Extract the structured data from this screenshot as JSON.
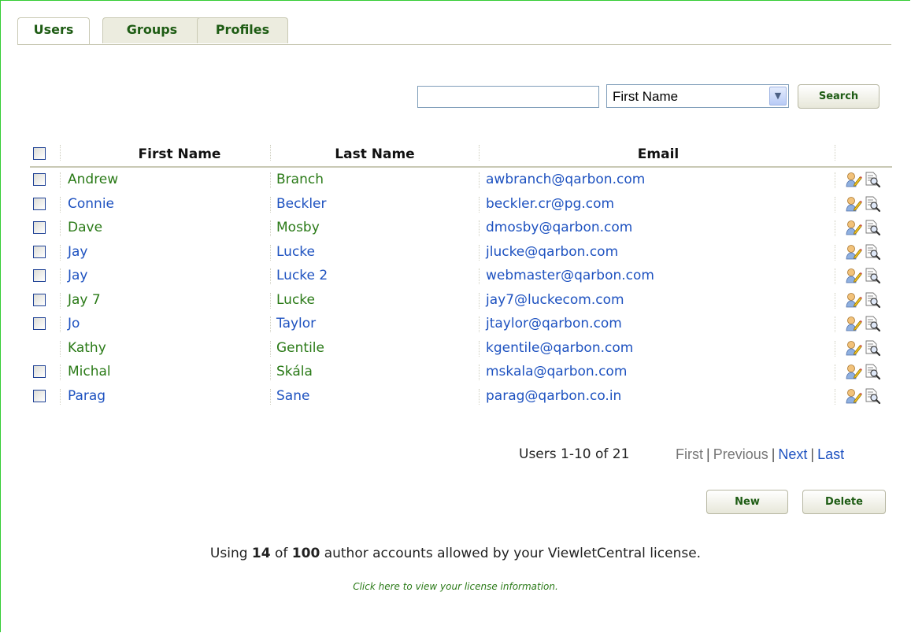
{
  "tabs": [
    {
      "label": "Users",
      "active": true
    },
    {
      "label": "Groups",
      "active": false
    },
    {
      "label": "Profiles",
      "active": false
    }
  ],
  "search": {
    "value": "",
    "field_selected": "First Name",
    "button_label": "Search"
  },
  "table": {
    "headers": {
      "first_name": "First Name",
      "last_name": "Last Name",
      "email": "Email"
    },
    "rows": [
      {
        "first": "Andrew",
        "last": "Branch",
        "email": "awbranch@qarbon.com",
        "checkbox": true,
        "color": "green"
      },
      {
        "first": "Connie",
        "last": "Beckler",
        "email": "beckler.cr@pg.com",
        "checkbox": true,
        "color": "blue"
      },
      {
        "first": "Dave",
        "last": "Mosby",
        "email": "dmosby@qarbon.com",
        "checkbox": true,
        "color": "green"
      },
      {
        "first": "Jay",
        "last": "Lucke",
        "email": "jlucke@qarbon.com",
        "checkbox": true,
        "color": "blue"
      },
      {
        "first": "Jay",
        "last": "Lucke 2",
        "email": "webmaster@qarbon.com",
        "checkbox": true,
        "color": "blue"
      },
      {
        "first": "Jay 7",
        "last": "Lucke",
        "email": "jay7@luckecom.com",
        "checkbox": true,
        "color": "green"
      },
      {
        "first": "Jo",
        "last": "Taylor",
        "email": "jtaylor@qarbon.com",
        "checkbox": true,
        "color": "blue"
      },
      {
        "first": "Kathy",
        "last": "Gentile",
        "email": "kgentile@qarbon.com",
        "checkbox": false,
        "color": "green"
      },
      {
        "first": "Michal",
        "last": "Skála",
        "email": "mskala@qarbon.com",
        "checkbox": true,
        "color": "green"
      },
      {
        "first": "Parag",
        "last": "Sane",
        "email": "parag@qarbon.co.in",
        "checkbox": true,
        "color": "blue"
      }
    ],
    "row_icons": [
      "edit-user-icon",
      "view-details-icon"
    ]
  },
  "pagination": {
    "summary": "Users 1-10 of 21",
    "first": "First",
    "previous": "Previous",
    "next": "Next",
    "last": "Last",
    "separator": "|"
  },
  "actions": {
    "new_label": "New",
    "delete_label": "Delete"
  },
  "license": {
    "prefix": "Using ",
    "used": "14",
    "middle": " of ",
    "total": "100",
    "suffix": " author accounts allowed by your ViewletCentral license.",
    "link_text": "Click here to view your license information."
  },
  "colors": {
    "green_link": "#2a7a17",
    "blue_link": "#1e52c0",
    "frame_border": "#33cc33"
  }
}
